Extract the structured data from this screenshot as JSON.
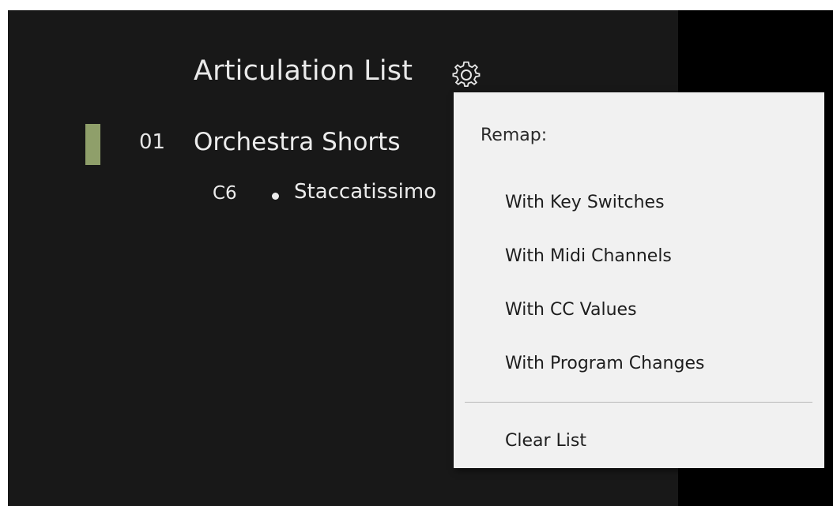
{
  "list": {
    "title": "Articulation List",
    "settings_icon": "gear-icon",
    "groups": [
      {
        "number": "01",
        "name": "Orchestra Shorts",
        "color": "#8f9f6a",
        "articulations": [
          {
            "key": "C6",
            "name": "Staccatissimo"
          }
        ]
      }
    ]
  },
  "menu": {
    "header": "Remap:",
    "items": [
      {
        "label": "With Key Switches"
      },
      {
        "label": "With Midi Channels"
      },
      {
        "label": "With CC Values"
      },
      {
        "label": "With Program Changes"
      }
    ],
    "clear_label": "Clear List"
  }
}
